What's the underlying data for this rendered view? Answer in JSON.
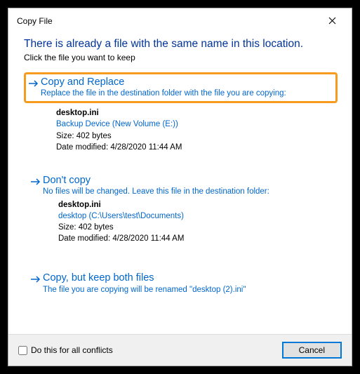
{
  "titlebar": {
    "title": "Copy File"
  },
  "heading": "There is already a file with the same name in this location.",
  "subheading": "Click the file you want to keep",
  "options": {
    "copyReplace": {
      "title": "Copy and Replace",
      "desc": "Replace the file in the destination folder with the file you are copying:",
      "file": {
        "name": "desktop.ini",
        "location": "Backup Device (New Volume (E:))",
        "size": "Size: 402 bytes",
        "modified": "Date modified: 4/28/2020 11:44 AM"
      }
    },
    "dontCopy": {
      "title": "Don't copy",
      "desc": "No files will be changed. Leave this file in the destination folder:",
      "file": {
        "name": "desktop.ini",
        "location": "desktop (C:\\Users\\test\\Documents)",
        "size": "Size: 402 bytes",
        "modified": "Date modified: 4/28/2020 11:44 AM"
      }
    },
    "keepBoth": {
      "title": "Copy, but keep both files",
      "desc": "The file you are copying will be renamed \"desktop (2).ini\""
    }
  },
  "footer": {
    "checkboxLabel": "Do this for all conflicts",
    "cancelLabel": "Cancel"
  }
}
